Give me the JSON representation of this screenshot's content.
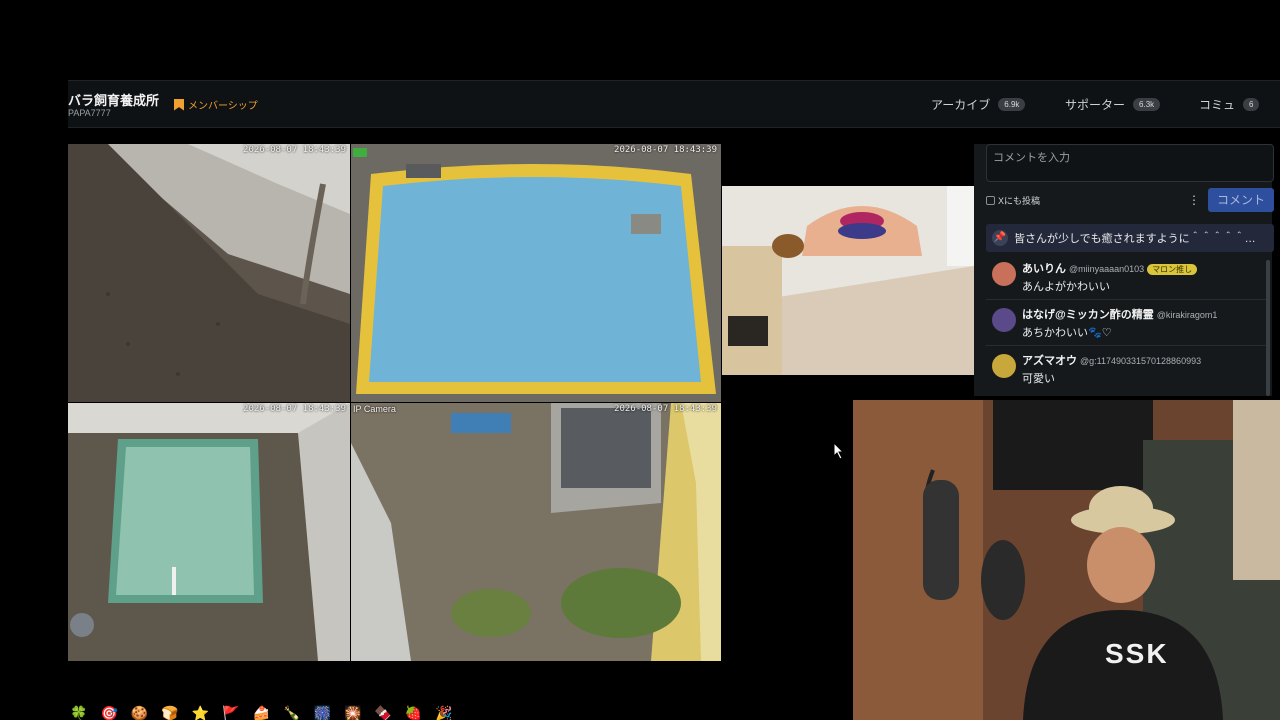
{
  "header": {
    "channel_name": "バラ飼育養成所",
    "channel_id": "PAPA7777",
    "membership_label": "メンバーシップ",
    "nav": [
      {
        "label": "アーカイブ",
        "count": "6.9k"
      },
      {
        "label": "サポーター",
        "count": "6.3k"
      },
      {
        "label": "コミュ",
        "count": "6"
      }
    ]
  },
  "cameras": {
    "cam1_timestamp": "2026-08-07 18:43:39",
    "cam2_timestamp": "2026-08-07 18:43:39",
    "cam3_timestamp": "2026-08-07 18:43:39",
    "cam4_label": "IP Camera",
    "cam4_timestamp": "2026-08-07 18:43:39"
  },
  "comments_panel": {
    "input_placeholder": "コメントを入力",
    "x_post_label": "Xにも投稿",
    "submit_label": "コメント",
    "pinned_text": "皆さんが少しでも癒されますように＾＾＾＾＾…",
    "comments": [
      {
        "user": "あいりん",
        "handle": "@miinyaaaan0103",
        "badge": "マロン推し",
        "text": "あんよがかわいい",
        "avatar_color": "#c8705a"
      },
      {
        "user": "はなげ@ミッカン酢の精霊",
        "handle": "@kirakiragom1",
        "badge": "",
        "text": "あちかわいい🐾♡",
        "avatar_color": "#5a4a8a"
      },
      {
        "user": "アズマオウ",
        "handle": "@g:117490331570128860993",
        "badge": "",
        "text": "可愛い",
        "avatar_color": "#c8a83a"
      }
    ]
  },
  "webcam": {
    "shirt_text": "SSK"
  },
  "emoji_strip": [
    "🍀",
    "🎯",
    "🍪",
    "🍞",
    "⭐",
    "🚩",
    "🍰",
    "🍾",
    "🎆",
    "🎇",
    "🍫",
    "🍓",
    "🎉"
  ]
}
